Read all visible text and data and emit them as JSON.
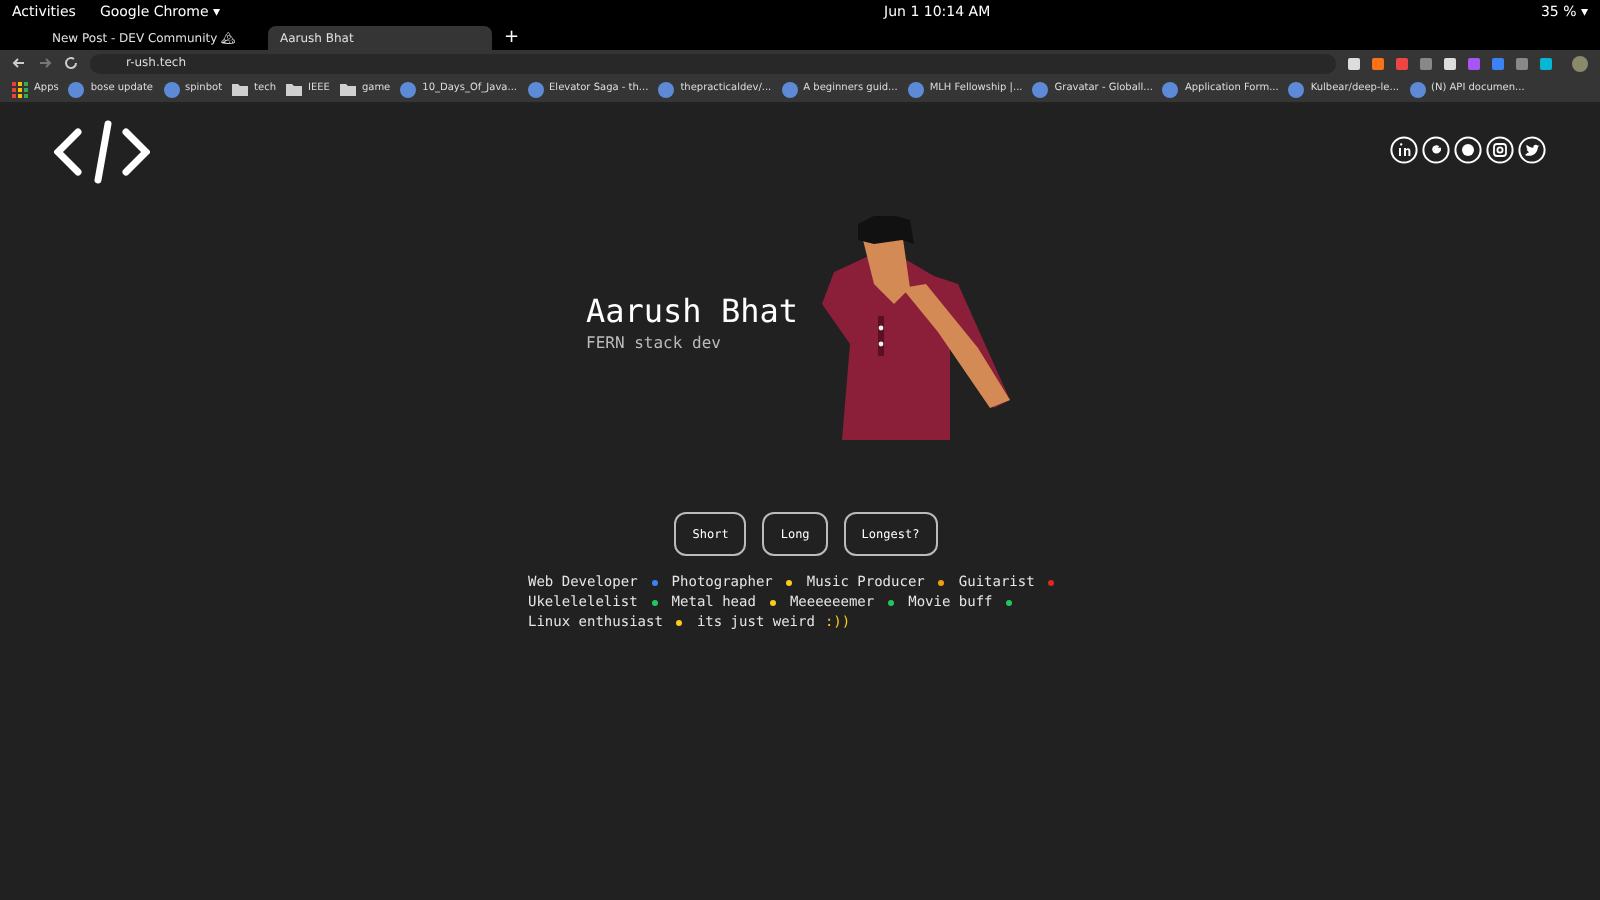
{
  "top_bar": {
    "activities": "Activities",
    "app": "Google Chrome ▾",
    "clock": "Jun 1  10:14 AM",
    "battery": "35 % ▾"
  },
  "tabs": [
    {
      "label": "New Post - DEV Community 🏔",
      "selected": false
    },
    {
      "label": "Aarush Bhat",
      "selected": true
    }
  ],
  "new_tab": "+",
  "address_bar": {
    "url": "r-ush.tech"
  },
  "bookmarks": [
    {
      "label": "Apps",
      "kind": "apps"
    },
    {
      "label": "bose update",
      "kind": "site"
    },
    {
      "label": "spinbot",
      "kind": "site"
    },
    {
      "label": "tech",
      "kind": "folder"
    },
    {
      "label": "IEEE",
      "kind": "folder"
    },
    {
      "label": "game",
      "kind": "folder"
    },
    {
      "label": "10_Days_Of_Java...",
      "kind": "site"
    },
    {
      "label": "Elevator Saga - th...",
      "kind": "site"
    },
    {
      "label": "thepracticaldev/...",
      "kind": "site"
    },
    {
      "label": "A beginners guid...",
      "kind": "site"
    },
    {
      "label": "MLH Fellowship |...",
      "kind": "site"
    },
    {
      "label": "Gravatar - Globall...",
      "kind": "site"
    },
    {
      "label": "Application Form...",
      "kind": "site"
    },
    {
      "label": "Kulbear/deep-le...",
      "kind": "site"
    },
    {
      "label": "(N) API documen...",
      "kind": "site"
    }
  ],
  "hero": {
    "name": "Aarush Bhat",
    "tagline": "FERN stack dev"
  },
  "length_buttons": [
    "Short",
    "Long",
    "Longest?"
  ],
  "bio": [
    {
      "text": "Web Developer",
      "color": "#3b82f6"
    },
    {
      "text": "Photographer",
      "color": "#facc15"
    },
    {
      "text": "Music Producer",
      "color": "#f59e0b"
    },
    {
      "text": "Guitarist",
      "color": "#dc2626"
    },
    {
      "text": "Ukelelelelist",
      "color": "#22c55e"
    },
    {
      "text": "Metal head",
      "color": "#facc15"
    },
    {
      "text": "Meeeeeemer",
      "color": "#22c55e"
    },
    {
      "text": "Movie buff",
      "color": "#22c55e"
    },
    {
      "text": "Linux enthusiast",
      "color": "#facc15"
    }
  ],
  "bio_end": {
    "text": "its just weird",
    "emoticon": ":))"
  }
}
